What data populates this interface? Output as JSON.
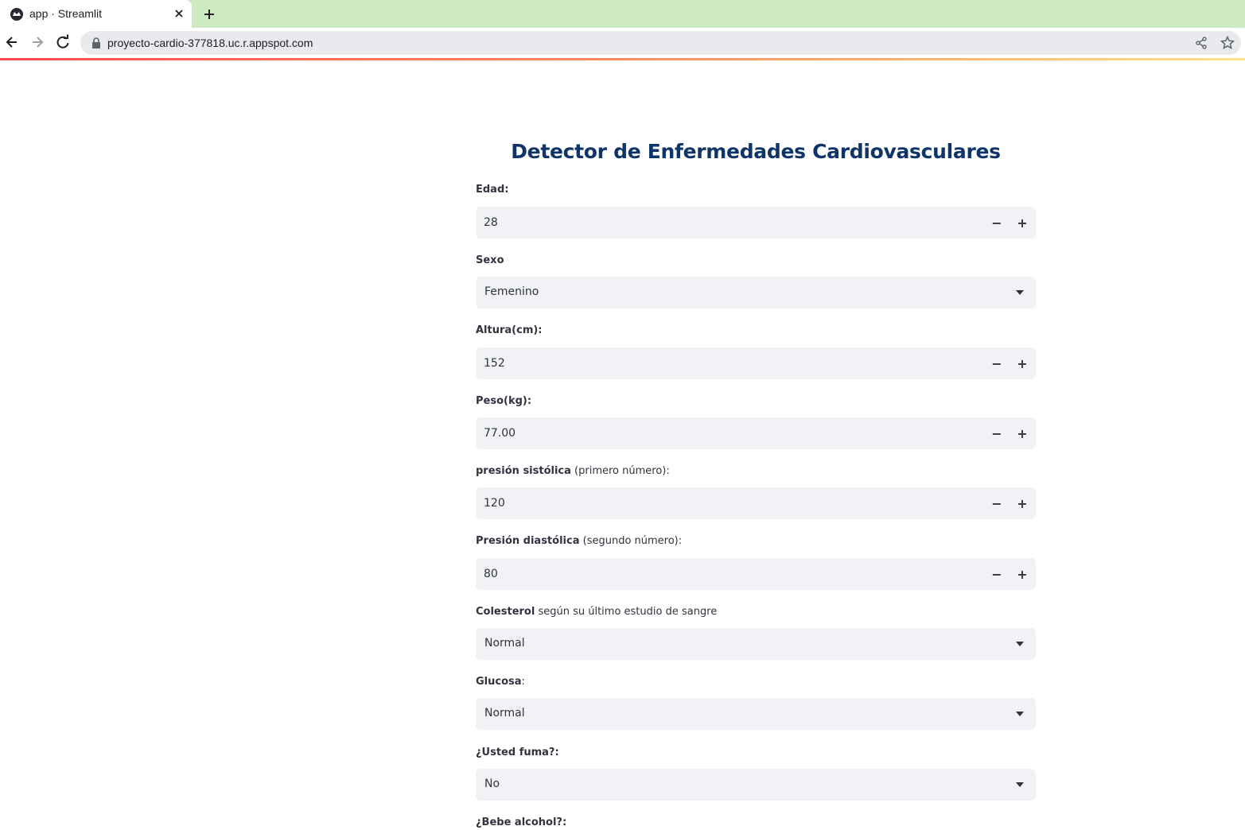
{
  "browser": {
    "tab_title": "app · Streamlit",
    "url": "proyecto-cardio-377818.uc.r.appspot.com"
  },
  "app": {
    "title": "Detector de Enfermedades Cardiovasculares",
    "fields": {
      "edad": {
        "label": "Edad:",
        "value": "28"
      },
      "sexo": {
        "label": "Sexo",
        "value": "Femenino"
      },
      "altura": {
        "label": "Altura(cm):",
        "value": "152"
      },
      "peso": {
        "label": "Peso(kg):",
        "value": "77.00"
      },
      "sistolica": {
        "label_bold": "presión sistólica",
        "label_rest": " (primero número):",
        "value": "120"
      },
      "diastolica": {
        "label_bold": "Presión diastólica",
        "label_rest": " (segundo número):",
        "value": "80"
      },
      "colesterol": {
        "label_bold": "Colesterol",
        "label_rest": " según su último estudio de sangre",
        "value": "Normal"
      },
      "glucosa": {
        "label_bold": "Glucosa",
        "label_rest": ":",
        "value": "Normal"
      },
      "fuma": {
        "label": "¿Usted fuma?:",
        "value": "No"
      },
      "alcohol": {
        "label": "¿Bebe alcohol?:"
      }
    },
    "stepper": {
      "minus": "−",
      "plus": "+"
    }
  }
}
